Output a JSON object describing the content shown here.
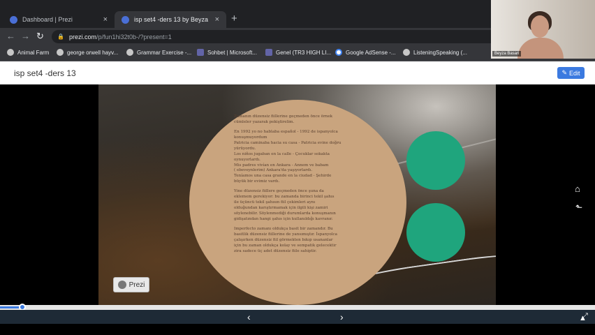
{
  "browser": {
    "tabs": [
      {
        "title": "Dashboard | Prezi",
        "close": "×"
      },
      {
        "title": "isp set4 -ders 13 by Beyza Başar",
        "close": "×"
      }
    ],
    "new_tab": "+",
    "url_host": "prezi.com",
    "url_path": "/p/fun1hi32t0b-/?present=1",
    "bookmarks": [
      "Animal Farm",
      "george orwell hayv...",
      "Grammar Exercise -...",
      "Sohbet | Microsoft...",
      "Genel (TR3 HIGH LI...",
      "Google AdSense -...",
      "ListeningSpeaking (..."
    ]
  },
  "webcam": {
    "name": "Beyza Basari"
  },
  "prezi": {
    "title": "isp set4 -ders 13",
    "edit_label": "Edit",
    "logo_text": "Prezi",
    "progress_fraction": 0.038
  },
  "slide": {
    "paragraphs": [
      [
        "Zamanın düzensiz fiillerine geçmeden önce örnek",
        "cümleler yazarak pekiştirelim."
      ],
      [
        "En 1992 yo no hablaba español - 1992 de ispanyolca",
        "konuşmuyordum",
        "Patricia caminaba hacia su casa - Patricia evine doğru",
        "yürüyordu.",
        "Los niños jugaban en la calle - Çocuklar sokakta",
        "oynuyorlardı.",
        "Mis padres vivían en Ankara - Annem ve babam",
        "( ebeveynlerim) Ankara'da yaşıyorlardı.",
        "Teníamos una casa grande en la ciudad - Şehirde",
        "büyük bir evimiz vardı."
      ],
      [
        "Yine düzensiz fiillere geçmeden önce şuna da",
        "eklemem gerekiyor: bu zamanda birinci tekil şahıs",
        "ile üçüncü tekil şahısın fiil çekimleri aynı",
        "olduğundan karıştırmamak için ilgili kişi zamiri",
        "söylenebilir. Söylenmediği durumlarda konuşmanın",
        "gidişatından hangi şahıs için kullanıldığı kavranır."
      ],
      [
        "Imperfecto zamanı oldukça basit bir zamandır. Bu",
        "basitlik düzensiz fiillerine de yansımıştır. İspanyolca",
        "çalışırken düzensiz fiil görmekten bıkıp usananlar",
        "için bu zaman oldukça kolay ve sempatik gelecektir",
        "zira sadece üç adet düzensiz fiile sahiptir."
      ]
    ]
  },
  "colors": {
    "circle_main": "#c9a47e",
    "circle_green": "#1fa57d",
    "accent": "#3b7ae0"
  }
}
